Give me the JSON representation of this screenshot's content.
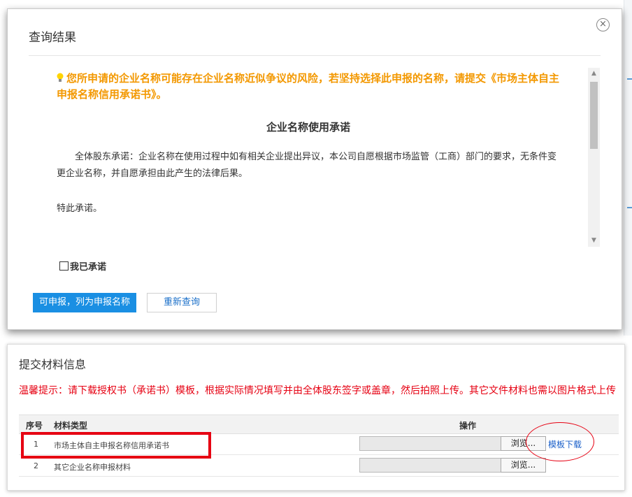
{
  "dialog": {
    "title": "查询结果",
    "close_glyph": "×",
    "warning": "您所申请的企业名称可能存在企业名称近似争议的风险，若坚持选择此申报的名称，请提交《市场主体自主申报名称信用承诺书》。",
    "promise_title": "企业名称使用承诺",
    "promise_body": "全体股东承诺：企业名称在使用过程中如有相关企业提出异议，本公司自愿根据市场监管（工商）部门的要求，无条件变更企业名称，并自愿承担由此产生的法律后果。",
    "promise_end": "特此承诺。",
    "agree_label": "我已承诺",
    "primary_button": "可申报，列为申报名称",
    "secondary_button": "重新查询"
  },
  "materials": {
    "title": "提交材料信息",
    "tip": "温馨提示：请下载授权书（承诺书）模板，根据实际情况填写并由全体股东签字或盖章，然后拍照上传。其它文件材料也需以图片格式上传",
    "columns": {
      "no": "序号",
      "type": "材料类型",
      "op": "操作"
    },
    "rows": [
      {
        "no": "1",
        "name": "市场主体自主申报名称信用承诺书",
        "browse": "浏览...",
        "link": "模板下载"
      },
      {
        "no": "2",
        "name": "其它企业名称申报材料",
        "browse": "浏览..."
      }
    ]
  },
  "colors": {
    "warning": "#f39800",
    "tip": "#e60012",
    "primary": "#1a8fe3",
    "link": "#1a5fc9",
    "highlight": "#e60012"
  }
}
